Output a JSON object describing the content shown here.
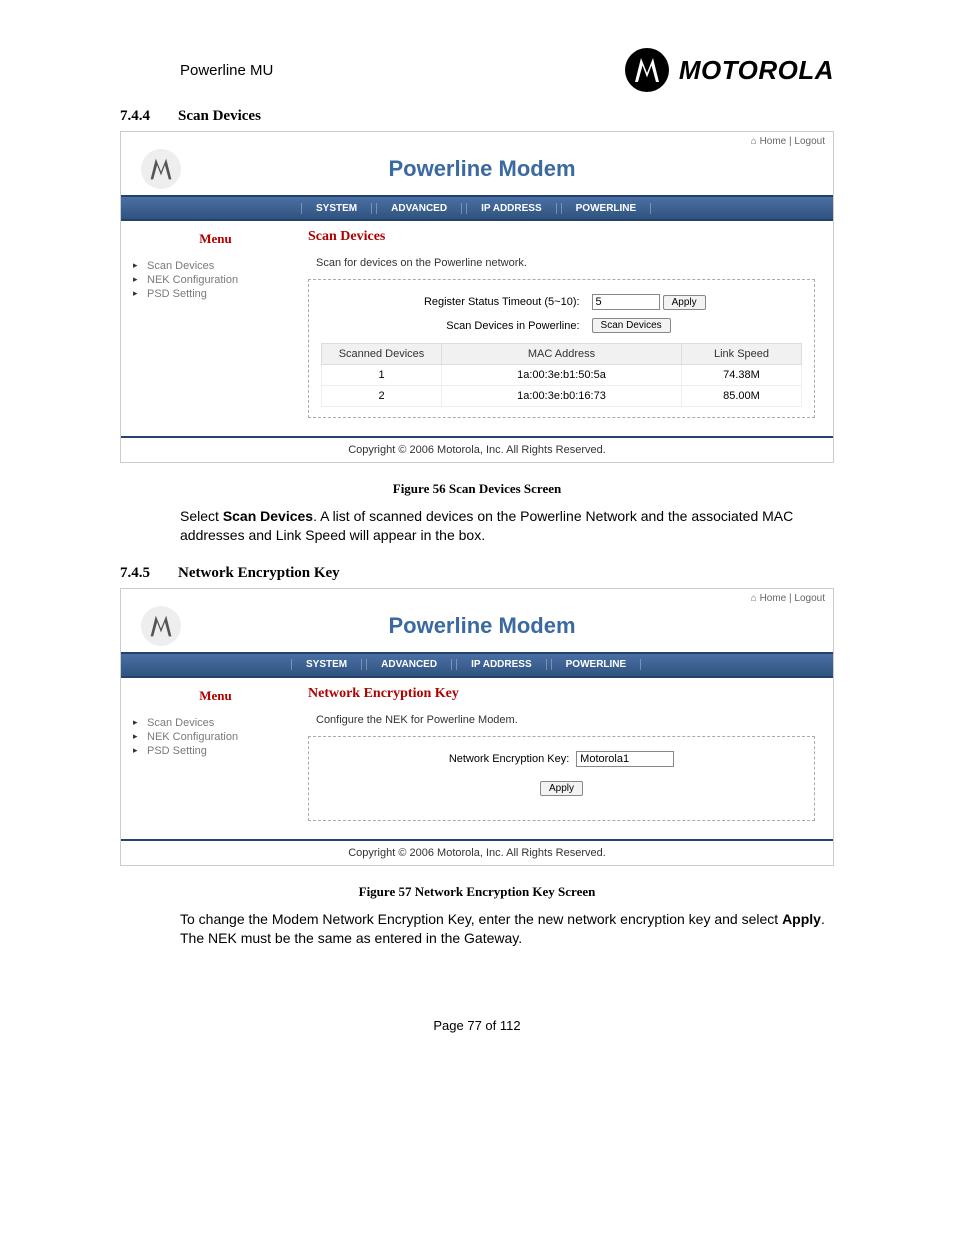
{
  "doc": {
    "header_title": "Powerline MU",
    "brand_word": "MOTOROLA",
    "page_label": "Page 77 of 112"
  },
  "sec744": {
    "num": "7.4.4",
    "title": "Scan Devices",
    "caption": "Figure 56 Scan Devices Screen",
    "body_before": "Select ",
    "body_bold": "Scan Devices",
    "body_after": ".  A list of scanned devices on the Powerline Network and the associated MAC addresses and Link Speed will appear in the box."
  },
  "sec745": {
    "num": "7.4.5",
    "title": "Network Encryption Key",
    "caption": "Figure 57 Network Encryption Key Screen",
    "body_before": "To change the Modem Network Encryption Key, enter the new network encryption key and select ",
    "body_bold": "Apply",
    "body_after": ". The NEK must be the same as entered in the Gateway."
  },
  "shot_common": {
    "home": "Home",
    "logout": "Logout",
    "title": "Powerline Modem",
    "tabs": [
      "SYSTEM",
      "ADVANCED",
      "IP ADDRESS",
      "POWERLINE"
    ],
    "menu_heading": "Menu",
    "menu_items": [
      "Scan Devices",
      "NEK Configuration",
      "PSD Setting"
    ],
    "copyright": "Copyright  ©   2006  Motorola, Inc.  All Rights Reserved."
  },
  "shot1": {
    "main_heading": "Scan Devices",
    "desc": "Scan for devices on the Powerline network.",
    "timeout_label": "Register Status Timeout (5~10):",
    "timeout_value": "5",
    "apply_label": "Apply",
    "scan_label": "Scan Devices in Powerline:",
    "scan_button": "Scan Devices",
    "th1": "Scanned Devices",
    "th2": "MAC Address",
    "th3": "Link Speed",
    "rows": [
      {
        "idx": "1",
        "mac": "1a:00:3e:b1:50:5a",
        "spd": "74.38M"
      },
      {
        "idx": "2",
        "mac": "1a:00:3e:b0:16:73",
        "spd": "85.00M"
      }
    ]
  },
  "shot2": {
    "main_heading": "Network Encryption Key",
    "desc": "Configure the NEK for Powerline Modem.",
    "field_label": "Network Encryption Key:",
    "field_value": "Motorola1",
    "apply_label": "Apply"
  }
}
